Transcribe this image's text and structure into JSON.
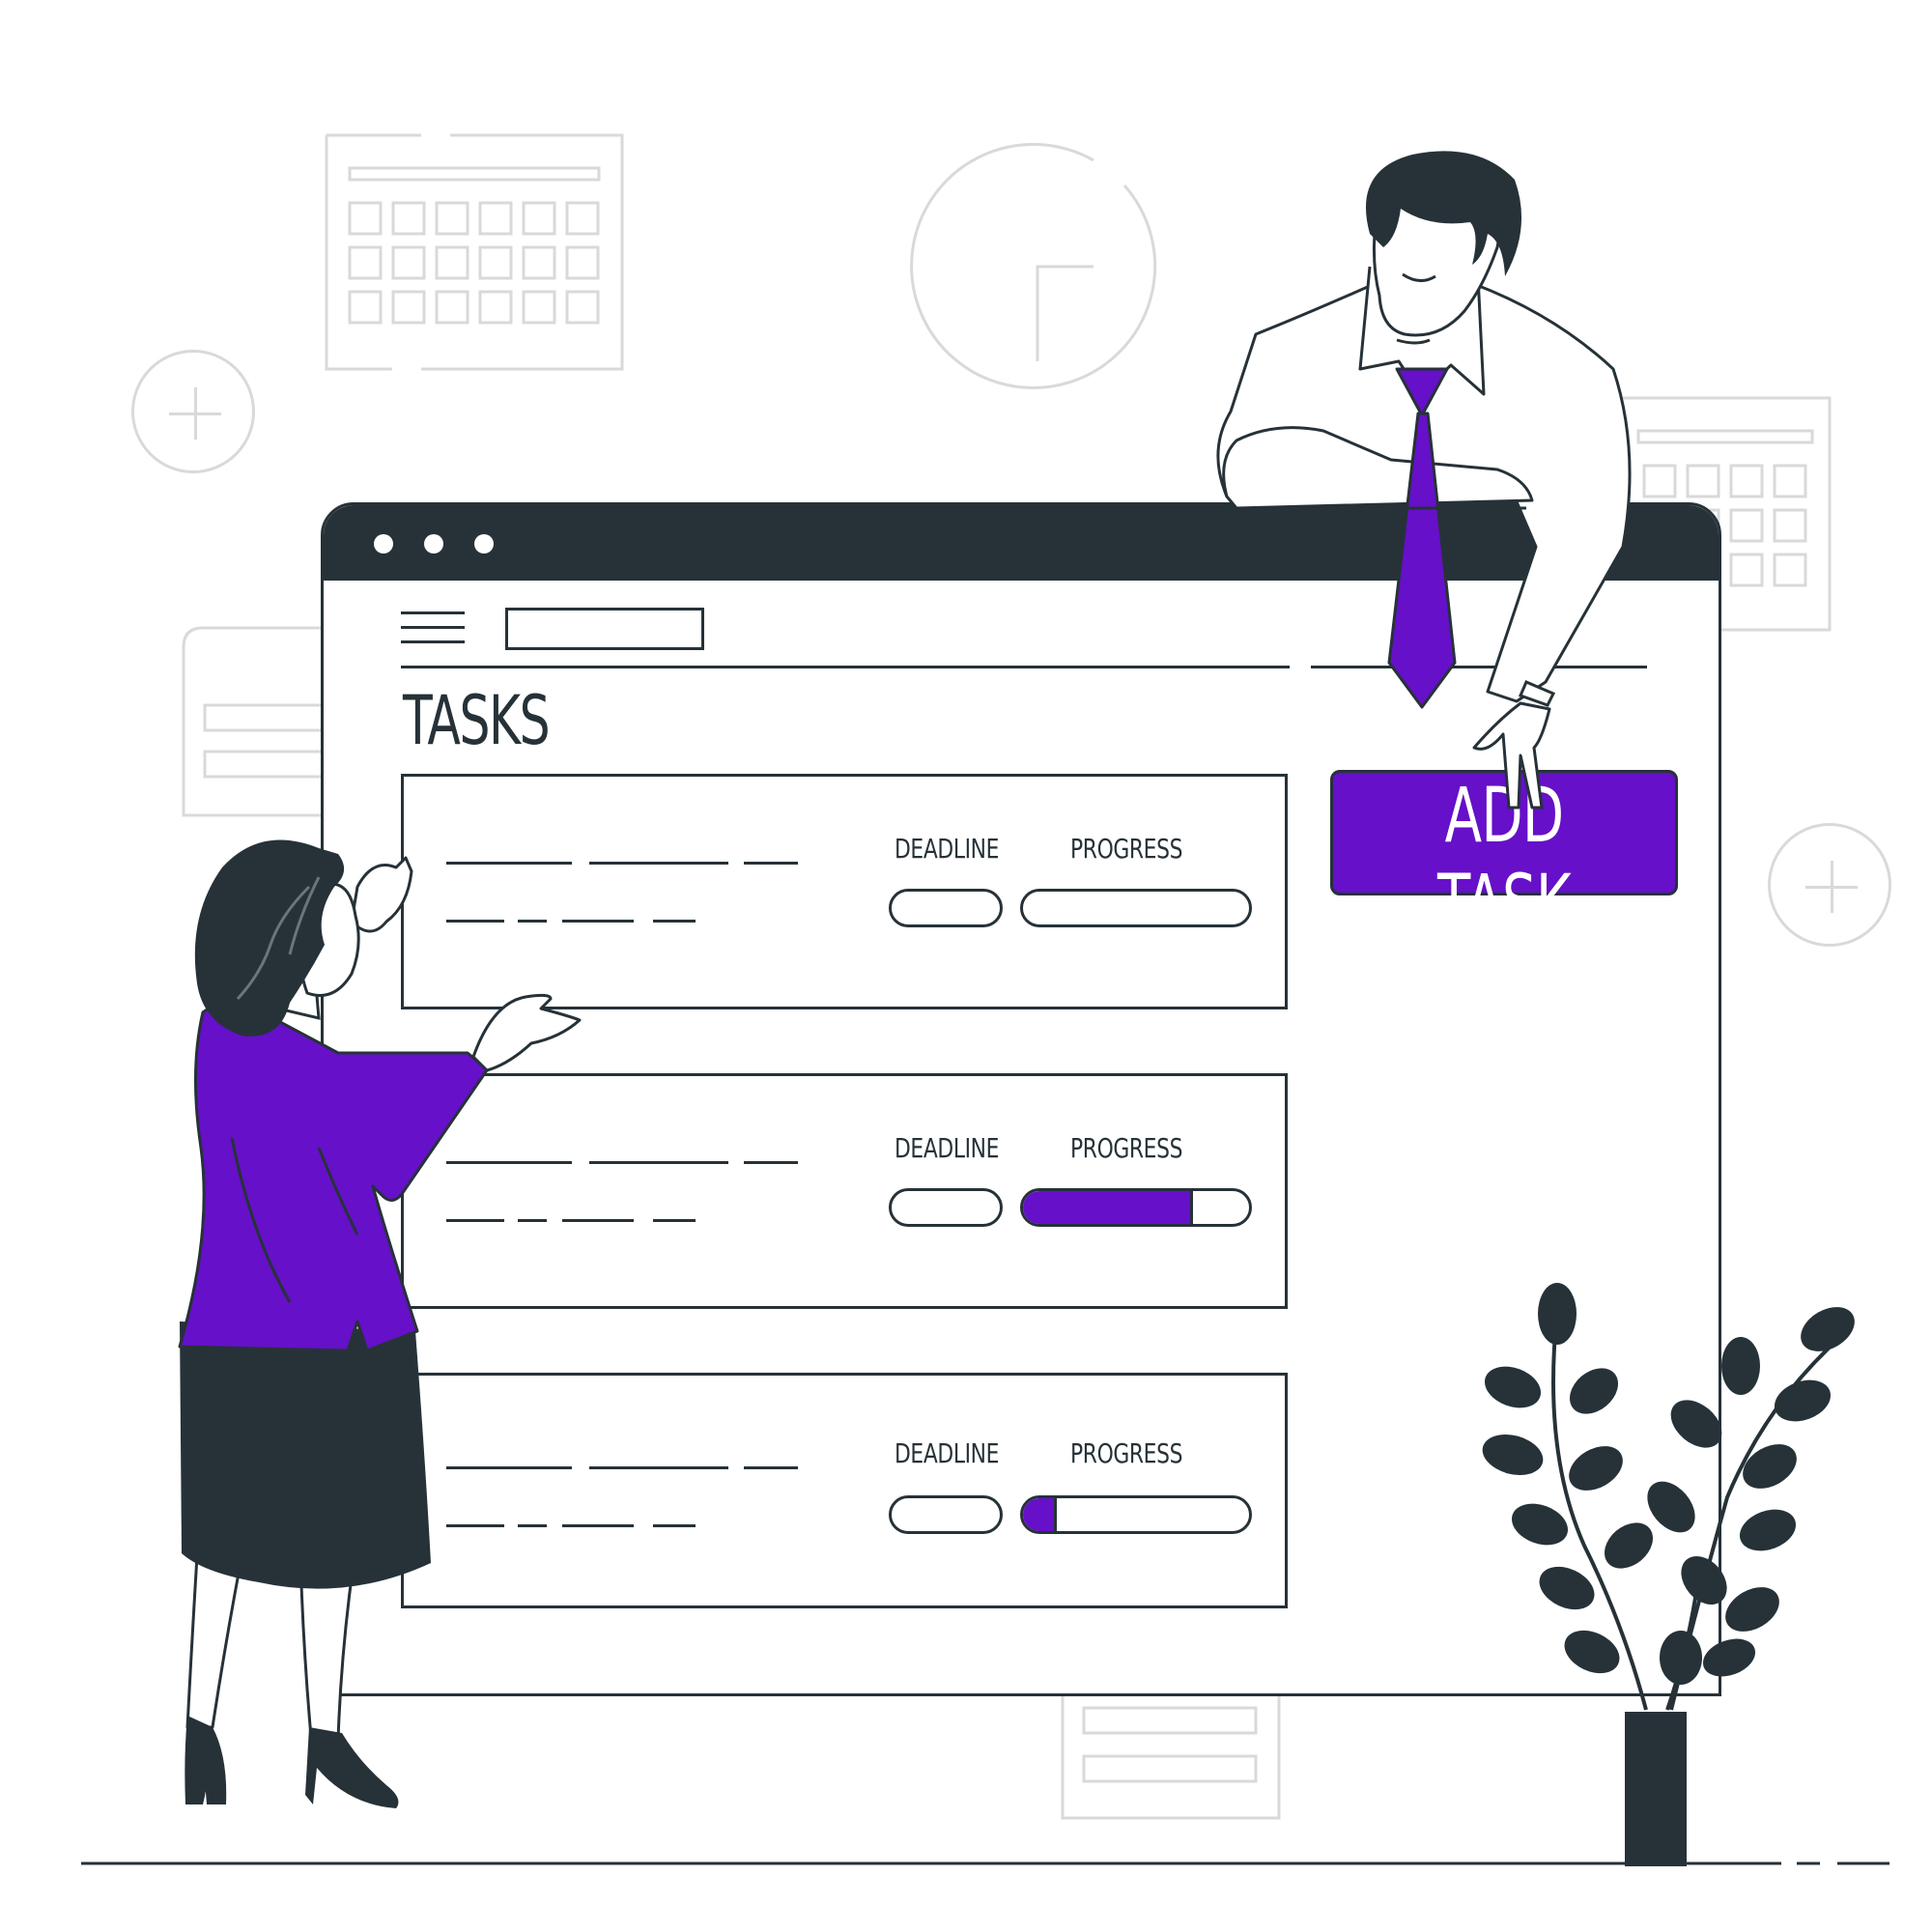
{
  "page": {
    "title": "TASKS",
    "add_task_label": "ADD TASK"
  },
  "tasks": [
    {
      "deadline_label": "DEADLINE",
      "progress_label": "PROGRESS",
      "progress": 0.0
    },
    {
      "deadline_label": "DEADLINE",
      "progress_label": "PROGRESS",
      "progress": 0.75
    },
    {
      "deadline_label": "DEADLINE",
      "progress_label": "PROGRESS",
      "progress": 0.15
    }
  ],
  "colors": {
    "accent": "#6610c9",
    "ink": "#263238",
    "decor": "#d9d9d9"
  },
  "icons": [
    "menu-icon",
    "window-dot-icon",
    "calendar-icon",
    "clock-icon",
    "plus-circle-icon",
    "plant-icon"
  ]
}
